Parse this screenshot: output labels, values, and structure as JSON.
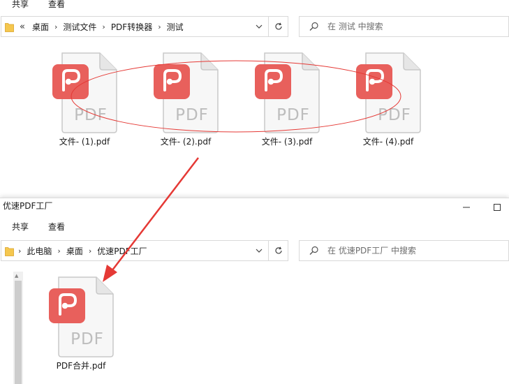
{
  "window1": {
    "ribbon": {
      "tabs": [
        "共享",
        "查看"
      ]
    },
    "address": {
      "overflow": "«",
      "crumbs": [
        "桌面",
        "测试文件",
        "PDF转换器",
        "测试"
      ]
    },
    "search_placeholder": "在 测试 中搜索",
    "files": [
      "文件- (1).pdf",
      "文件- (2).pdf",
      "文件- (3).pdf",
      "文件- (4).pdf"
    ]
  },
  "window2": {
    "title": "优速PDF工厂",
    "ribbon": {
      "tabs": [
        "共享",
        "查看"
      ]
    },
    "address": {
      "crumbs": [
        "此电脑",
        "桌面",
        "优速PDF工厂"
      ]
    },
    "search_placeholder": "在 优速PDF工厂 中搜索",
    "files": [
      "PDF合并.pdf"
    ]
  },
  "pdf_badge_text": "PDF",
  "colors": {
    "pdf_red": "#e8605c",
    "annotation_red": "#e53935",
    "border": "#d9d9d9"
  }
}
